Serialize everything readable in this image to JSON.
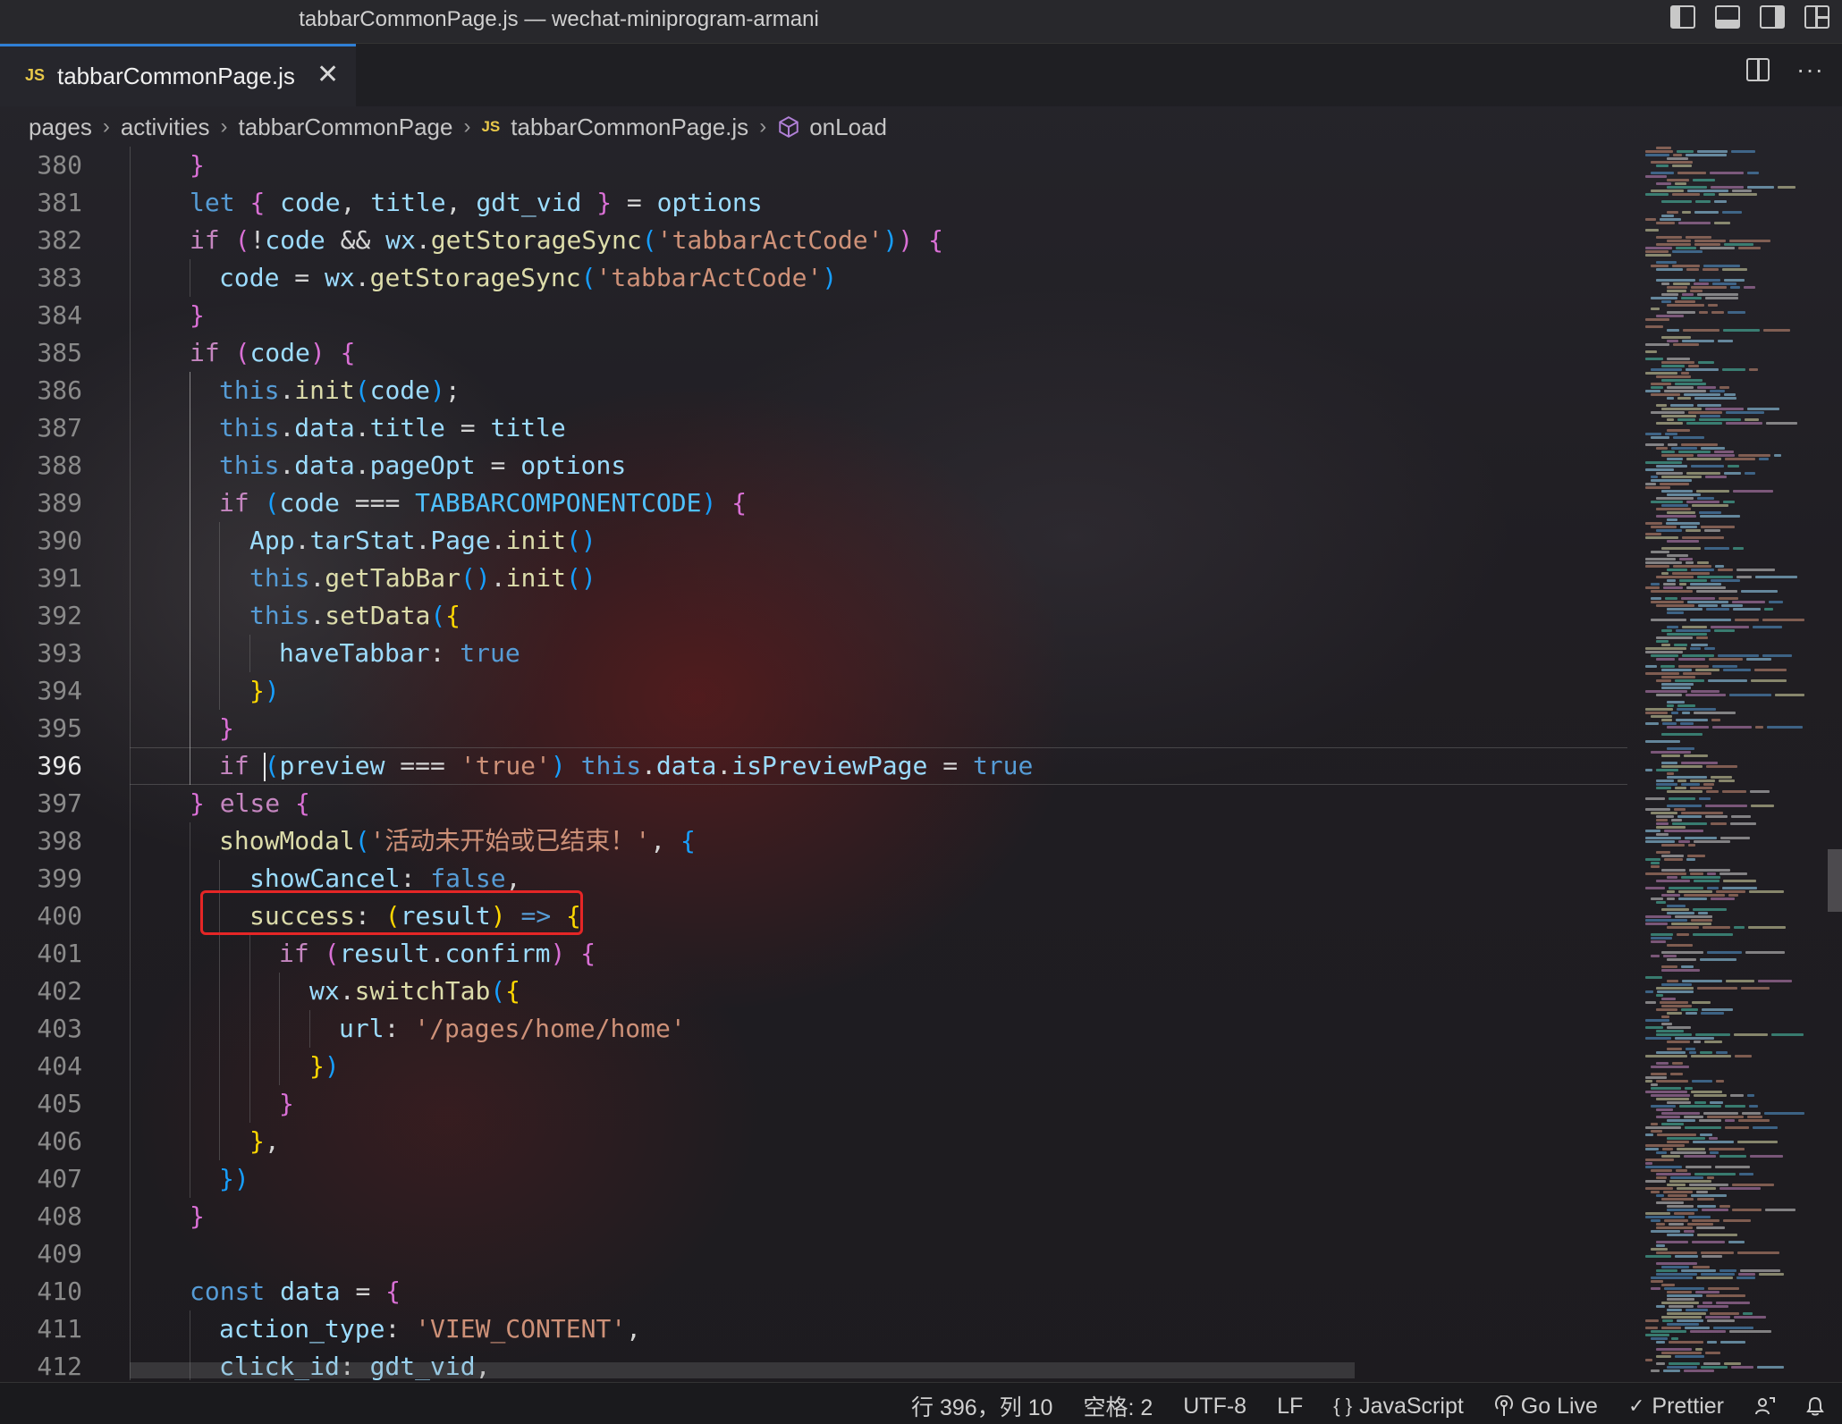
{
  "window": {
    "title": "tabbarCommonPage.js — wechat-miniprogram-armani"
  },
  "tab": {
    "label": "tabbarCommonPage.js",
    "badge": "JS",
    "close": "✕"
  },
  "breadcrumb": {
    "items": [
      "pages",
      "activities",
      "tabbarCommonPage",
      "tabbarCommonPage.js",
      "onLoad"
    ],
    "file_badge": "JS"
  },
  "editor": {
    "active_line": "396",
    "lines": [
      {
        "n": "380"
      },
      {
        "n": "381"
      },
      {
        "n": "382"
      },
      {
        "n": "383"
      },
      {
        "n": "384"
      },
      {
        "n": "385"
      },
      {
        "n": "386"
      },
      {
        "n": "387"
      },
      {
        "n": "388"
      },
      {
        "n": "389"
      },
      {
        "n": "390"
      },
      {
        "n": "391"
      },
      {
        "n": "392"
      },
      {
        "n": "393"
      },
      {
        "n": "394"
      },
      {
        "n": "395"
      },
      {
        "n": "396"
      },
      {
        "n": "397"
      },
      {
        "n": "398"
      },
      {
        "n": "399"
      },
      {
        "n": "400"
      },
      {
        "n": "401"
      },
      {
        "n": "402"
      },
      {
        "n": "403"
      },
      {
        "n": "404"
      },
      {
        "n": "405"
      },
      {
        "n": "406"
      },
      {
        "n": "407"
      },
      {
        "n": "408"
      },
      {
        "n": "409"
      },
      {
        "n": "410"
      },
      {
        "n": "411"
      },
      {
        "n": "412"
      }
    ]
  },
  "statusbar": {
    "position": "行 396，列 10",
    "indent": "空格: 2",
    "encoding": "UTF-8",
    "eol": "LF",
    "language": "JavaScript",
    "language_glyph": "{ }",
    "golive": "Go Live",
    "prettier": "Prettier"
  },
  "colors": {
    "accent": "#2f7fd6",
    "highlight_box": "#e52626"
  }
}
